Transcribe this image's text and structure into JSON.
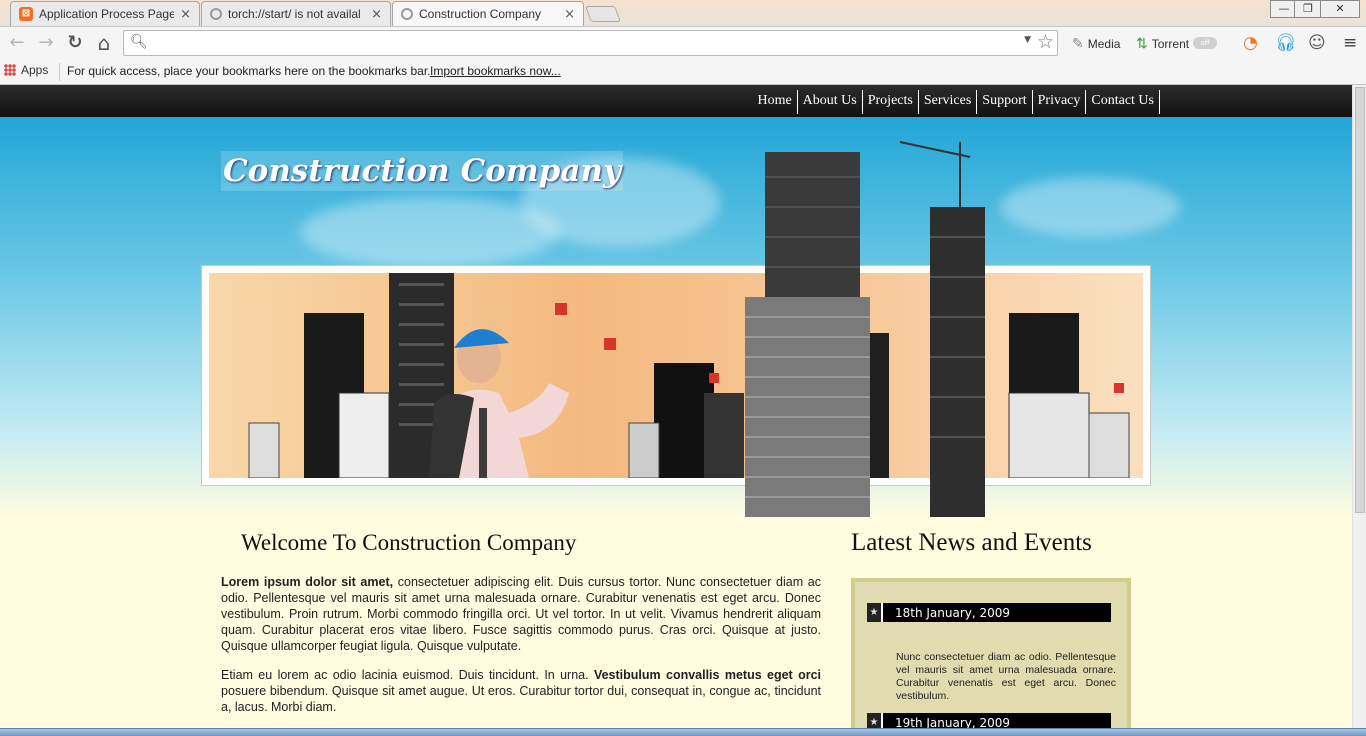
{
  "browser": {
    "tabs": [
      {
        "label": "Application Process Page",
        "icon": "xampp-icon",
        "close": "×"
      },
      {
        "label": "torch://start/ is not availal",
        "icon": "torch-icon",
        "close": "×"
      },
      {
        "label": "Construction Company",
        "icon": "torch-icon",
        "close": "×"
      }
    ],
    "window_controls": {
      "minimize": "—",
      "maximize": "❐",
      "close": "✕"
    },
    "toolbar": {
      "back": "←",
      "forward": "→",
      "reload": "↻",
      "home": "⌂",
      "address_value": "",
      "ext_media": "Media",
      "ext_torrent": "Torrent",
      "toggle_text": "off"
    },
    "bookmarks_bar": {
      "apps_label": "Apps",
      "message": "For quick access, place your bookmarks here on the bookmarks bar.",
      "import_link": "Import bookmarks now..."
    }
  },
  "page": {
    "nav": [
      "Home",
      "About Us",
      "Projects",
      "Services",
      "Support",
      "Privacy",
      "Contact Us"
    ],
    "site_title": "Construction Company",
    "welcome_title": "Welcome To Construction Company",
    "para1_bold": "Lorem ipsum dolor sit amet,",
    "para1_text": " consectetuer adipiscing elit. Duis cursus tortor. Nunc consectetuer diam ac odio. Pellentesque vel mauris sit amet urna malesuada ornare. Curabitur venenatis est eget arcu. Donec vestibulum. Proin rutrum. Morbi commodo fringilla orci. Ut vel tortor. In ut velit. Vivamus hendrerit aliquam quam. Curabitur placerat eros vitae libero. Fusce sagittis commodo purus. Cras orci. Quisque at justo. Quisque ullamcorper feugiat ligula. Quisque vulputate.",
    "para2_text_a": "Etiam eu lorem ac odio lacinia euismod. Duis tincidunt. In urna. ",
    "para2_bold": "Vestibulum convallis metus eget orci",
    "para2_text_b": " posuere bibendum. Quisque sit amet augue. Ut eros. Curabitur tortor dui, consequat in, congue ac, tincidunt a, lacus. Morbi diam.",
    "news_title": "Latest News and Events",
    "news": [
      {
        "date": "18th January, 2009",
        "text": "Nunc consectetuer diam ac odio. Pellentesque vel mauris sit amet urna malesuada ornare. Curabitur venenatis est eget arcu. Donec vestibulum."
      },
      {
        "date": "19th January, 2009",
        "text": ""
      }
    ]
  }
}
